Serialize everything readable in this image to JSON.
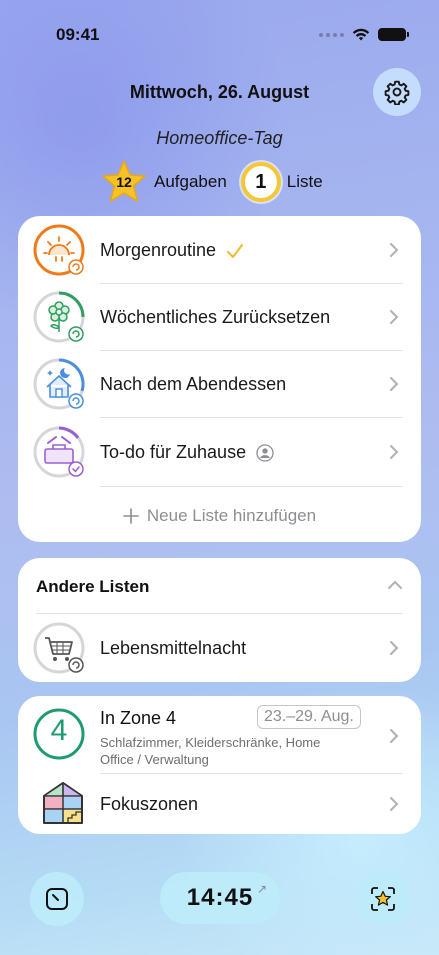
{
  "status_bar": {
    "time": "09:41"
  },
  "header": {
    "date": "Mittwoch, 26. August",
    "subtitle": "Homeoffice-Tag",
    "tasks_count": "12",
    "tasks_label": "Aufgaben",
    "lists_count": "1",
    "lists_label": "Liste"
  },
  "lists": [
    {
      "label": "Morgenroutine",
      "icon": "sunrise-icon",
      "status_icon": "checkmark-icon",
      "color": "#f07a1a"
    },
    {
      "label": "Wöchentliches Zurücksetzen",
      "icon": "flower-icon",
      "color": "#2f9e5e"
    },
    {
      "label": "Nach dem Abendessen",
      "icon": "night-house-icon",
      "color": "#4a8ee0"
    },
    {
      "label": "To-do für Zuhause",
      "icon": "toolbox-icon",
      "status_icon": "person-icon",
      "color": "#9b5fd4"
    }
  ],
  "add_list_label": "Neue Liste hinzufügen",
  "other_lists": {
    "title": "Andere Listen",
    "items": [
      {
        "label": "Lebensmittelnacht",
        "icon": "shopping-cart-icon"
      }
    ]
  },
  "zones": {
    "current": {
      "number": "4",
      "title": "In Zone 4",
      "date_range": "23.–29. Aug.",
      "description": "Schlafzimmer, Kleiderschränke, Home Office / Verwaltung",
      "color": "#1f9b72"
    },
    "focus_label": "Fokuszonen"
  },
  "bottom_bar": {
    "timer": "14:45"
  }
}
